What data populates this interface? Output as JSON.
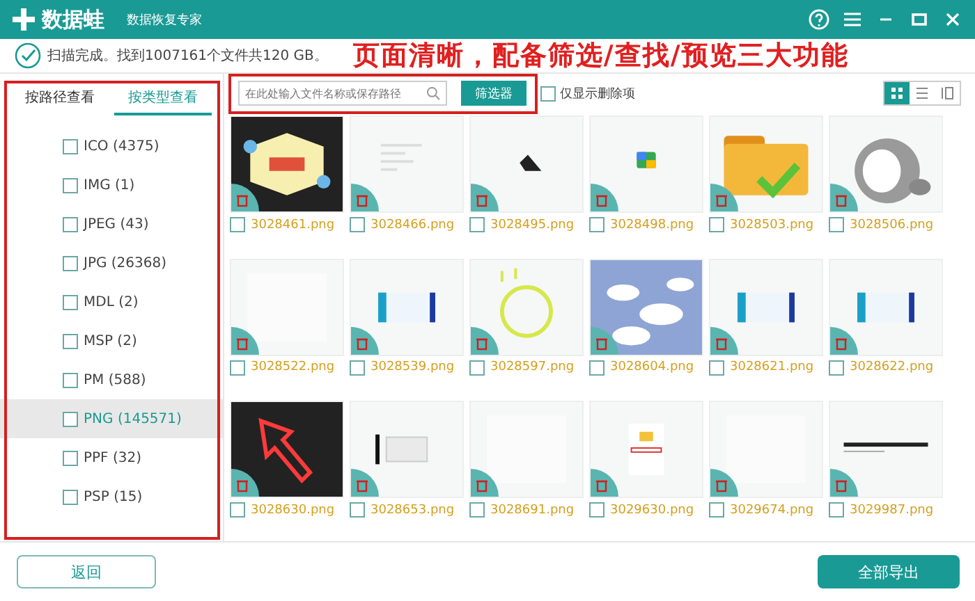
{
  "window": {
    "app_name": "数据蛙",
    "subtitle": "数据恢复专家"
  },
  "status": {
    "message": "扫描完成。找到1007161个文件共120 GB。",
    "annotation": "页面清晰，配备筛选/查找/预览三大功能"
  },
  "sidebar": {
    "tabs": [
      {
        "label": "按路径查看",
        "selected": false
      },
      {
        "label": "按类型查看",
        "selected": true
      }
    ],
    "items": [
      {
        "label": "ICO (4375)",
        "checked": false,
        "selected": false
      },
      {
        "label": "IMG (1)",
        "checked": false,
        "selected": false
      },
      {
        "label": "JPEG (43)",
        "checked": false,
        "selected": false
      },
      {
        "label": "JPG (26368)",
        "checked": false,
        "selected": false
      },
      {
        "label": "MDL (2)",
        "checked": false,
        "selected": false
      },
      {
        "label": "MSP (2)",
        "checked": false,
        "selected": false
      },
      {
        "label": "PM (588)",
        "checked": false,
        "selected": false
      },
      {
        "label": "PNG (145571)",
        "checked": false,
        "selected": true
      },
      {
        "label": "PPF (32)",
        "checked": false,
        "selected": false
      },
      {
        "label": "PSP (15)",
        "checked": false,
        "selected": false
      }
    ]
  },
  "toolbar": {
    "search": {
      "placeholder": "在此处输入文件名称或保存路径"
    },
    "filter_button": "筛选器",
    "deleted_only": {
      "label": "仅显示删除项",
      "checked": false
    },
    "views": [
      {
        "kind": "grid",
        "selected": true
      },
      {
        "kind": "list",
        "selected": false
      },
      {
        "kind": "columns",
        "selected": false
      }
    ]
  },
  "files": [
    {
      "name": "3028461.png",
      "checked": false
    },
    {
      "name": "3028466.png",
      "checked": false
    },
    {
      "name": "3028495.png",
      "checked": false
    },
    {
      "name": "3028498.png",
      "checked": false
    },
    {
      "name": "3028503.png",
      "checked": false
    },
    {
      "name": "3028506.png",
      "checked": false
    },
    {
      "name": "3028522.png",
      "checked": false
    },
    {
      "name": "3028539.png",
      "checked": false
    },
    {
      "name": "3028597.png",
      "checked": false
    },
    {
      "name": "3028604.png",
      "checked": false
    },
    {
      "name": "3028621.png",
      "checked": false
    },
    {
      "name": "3028622.png",
      "checked": false
    },
    {
      "name": "3028630.png",
      "checked": false
    },
    {
      "name": "3028653.png",
      "checked": false
    },
    {
      "name": "3028691.png",
      "checked": false
    },
    {
      "name": "3029630.png",
      "checked": false
    },
    {
      "name": "3029674.png",
      "checked": false
    },
    {
      "name": "3029987.png",
      "checked": false
    }
  ],
  "buttons": {
    "back": "返回",
    "export_all": "全部导出"
  }
}
